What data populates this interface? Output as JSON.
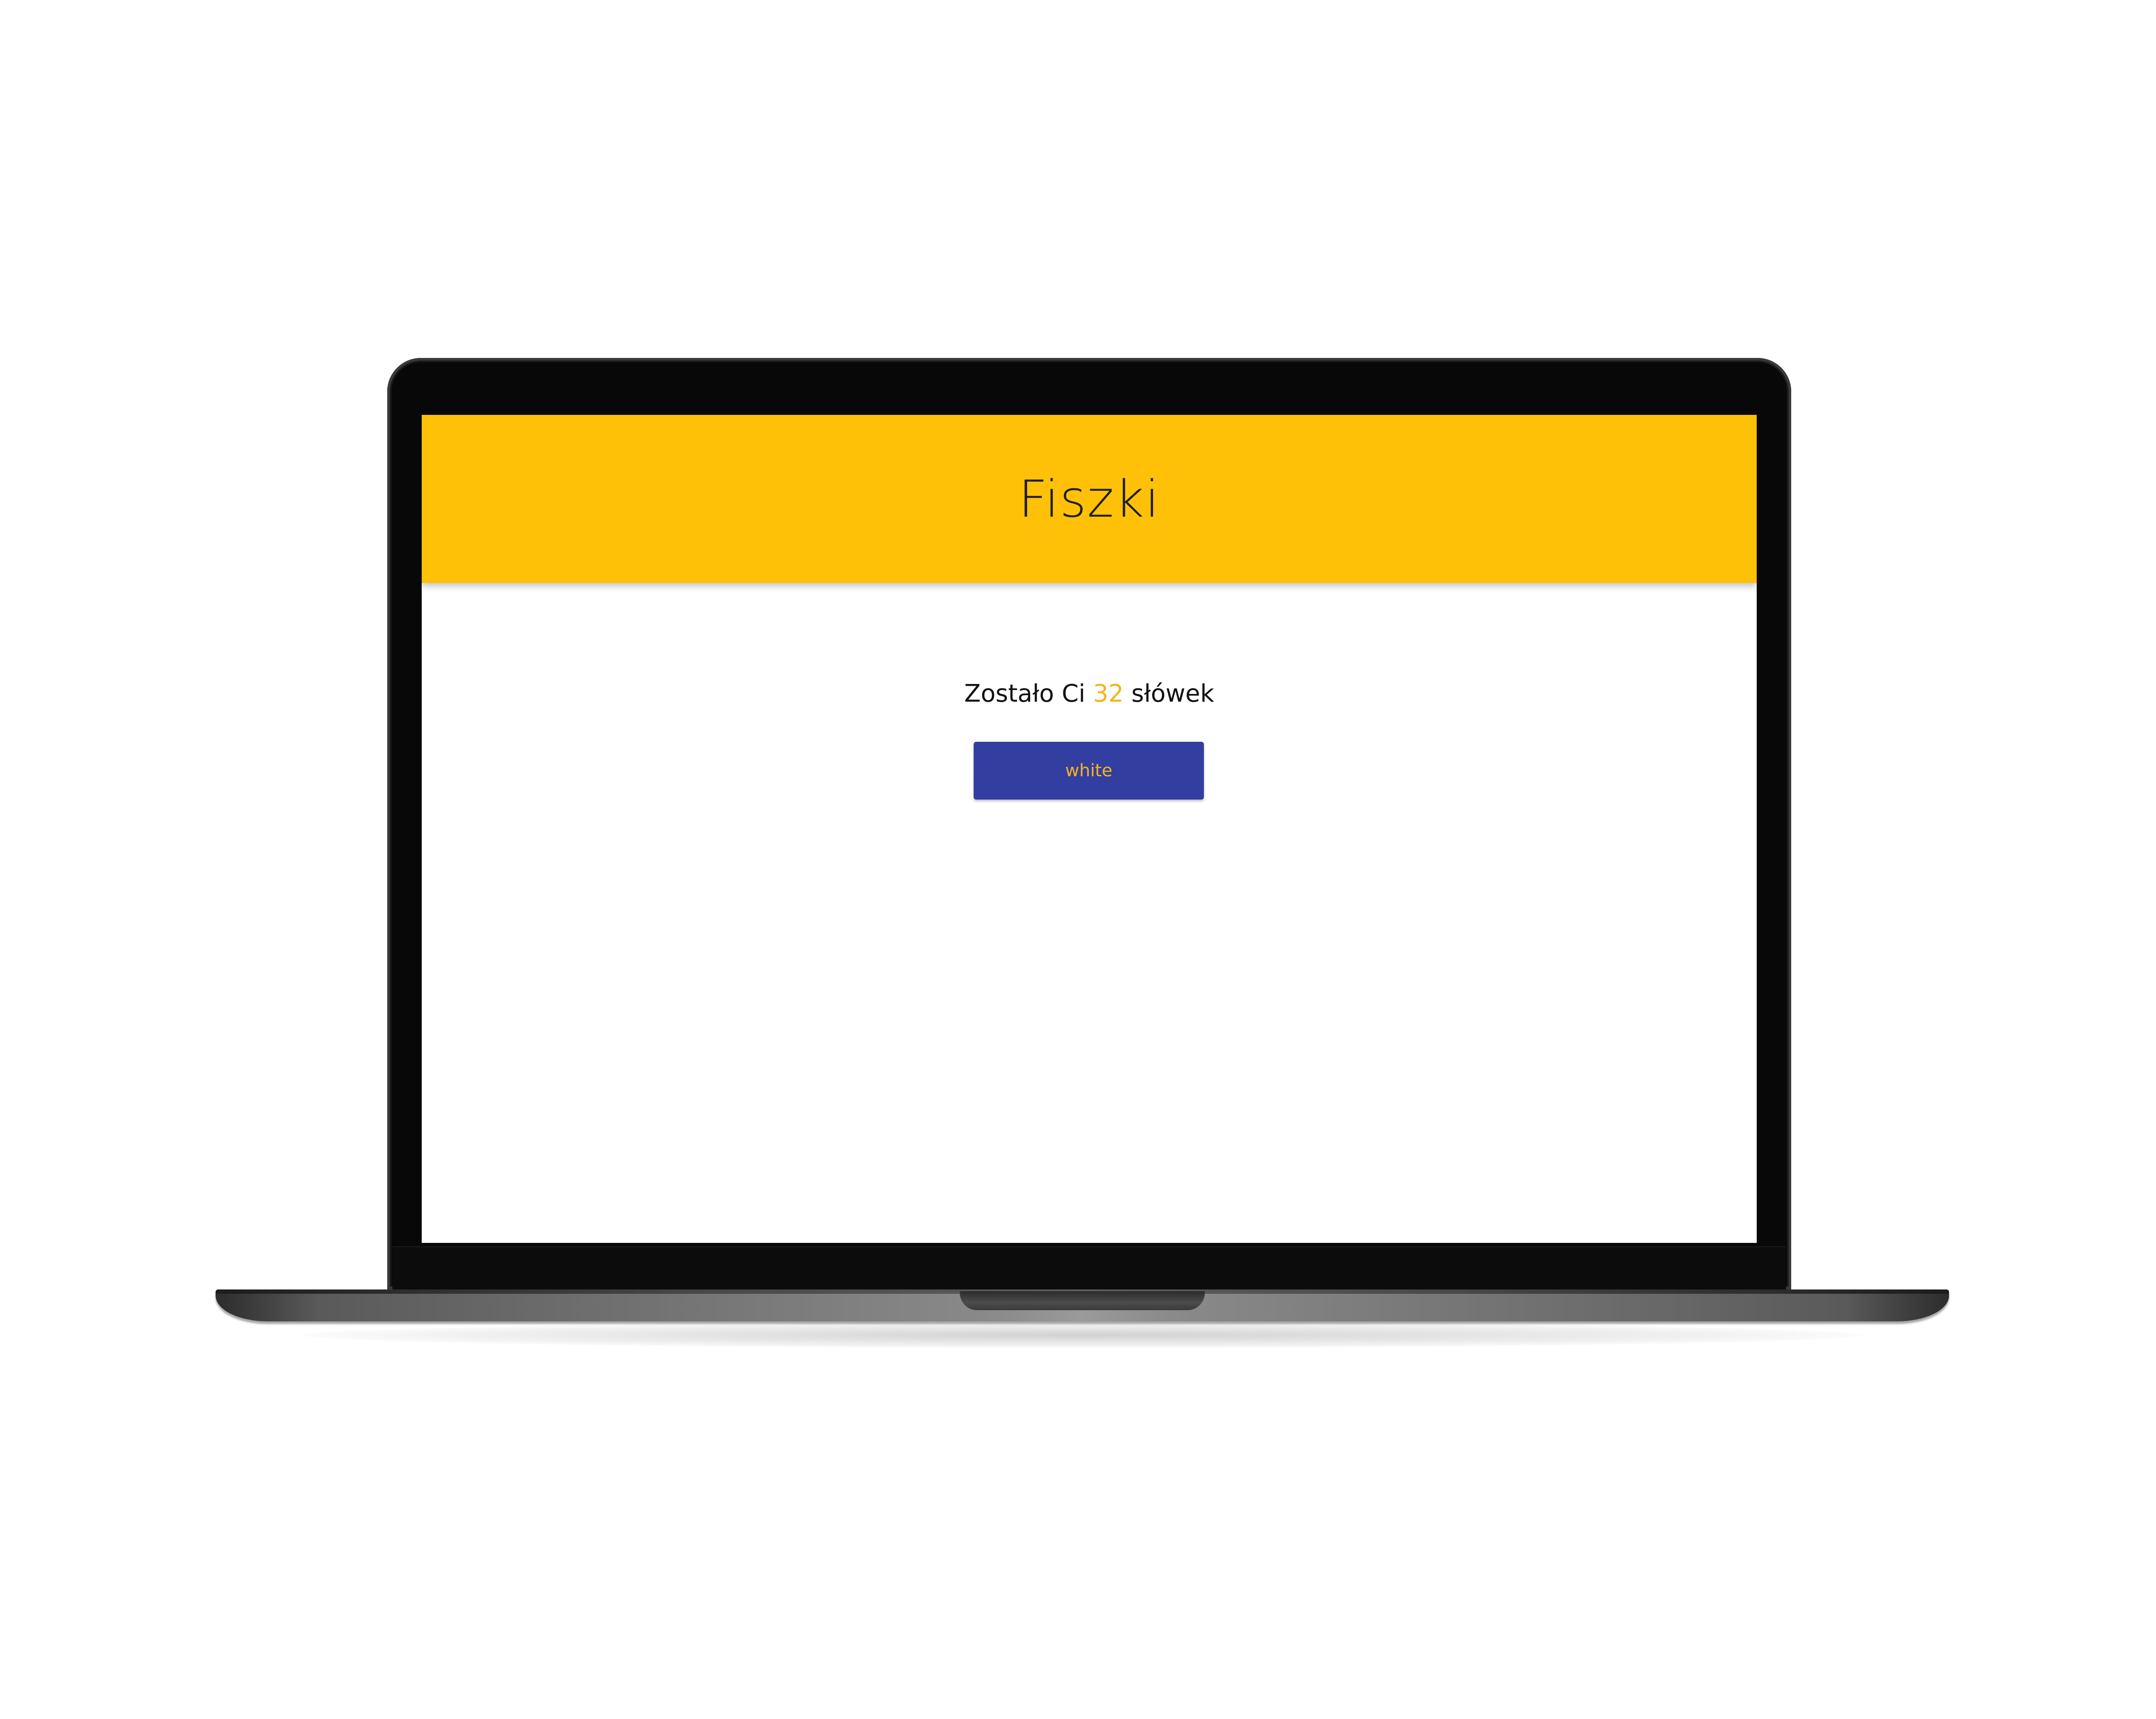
{
  "app": {
    "title": "Fiszki",
    "header_color": "#fec107"
  },
  "counter": {
    "prefix": "Zostało Ci",
    "count": "32",
    "suffix": "słówek",
    "count_color": "#f5b41c"
  },
  "word_button": {
    "label": "white",
    "background": "#333ea1",
    "text_color": "#f5b41c"
  }
}
